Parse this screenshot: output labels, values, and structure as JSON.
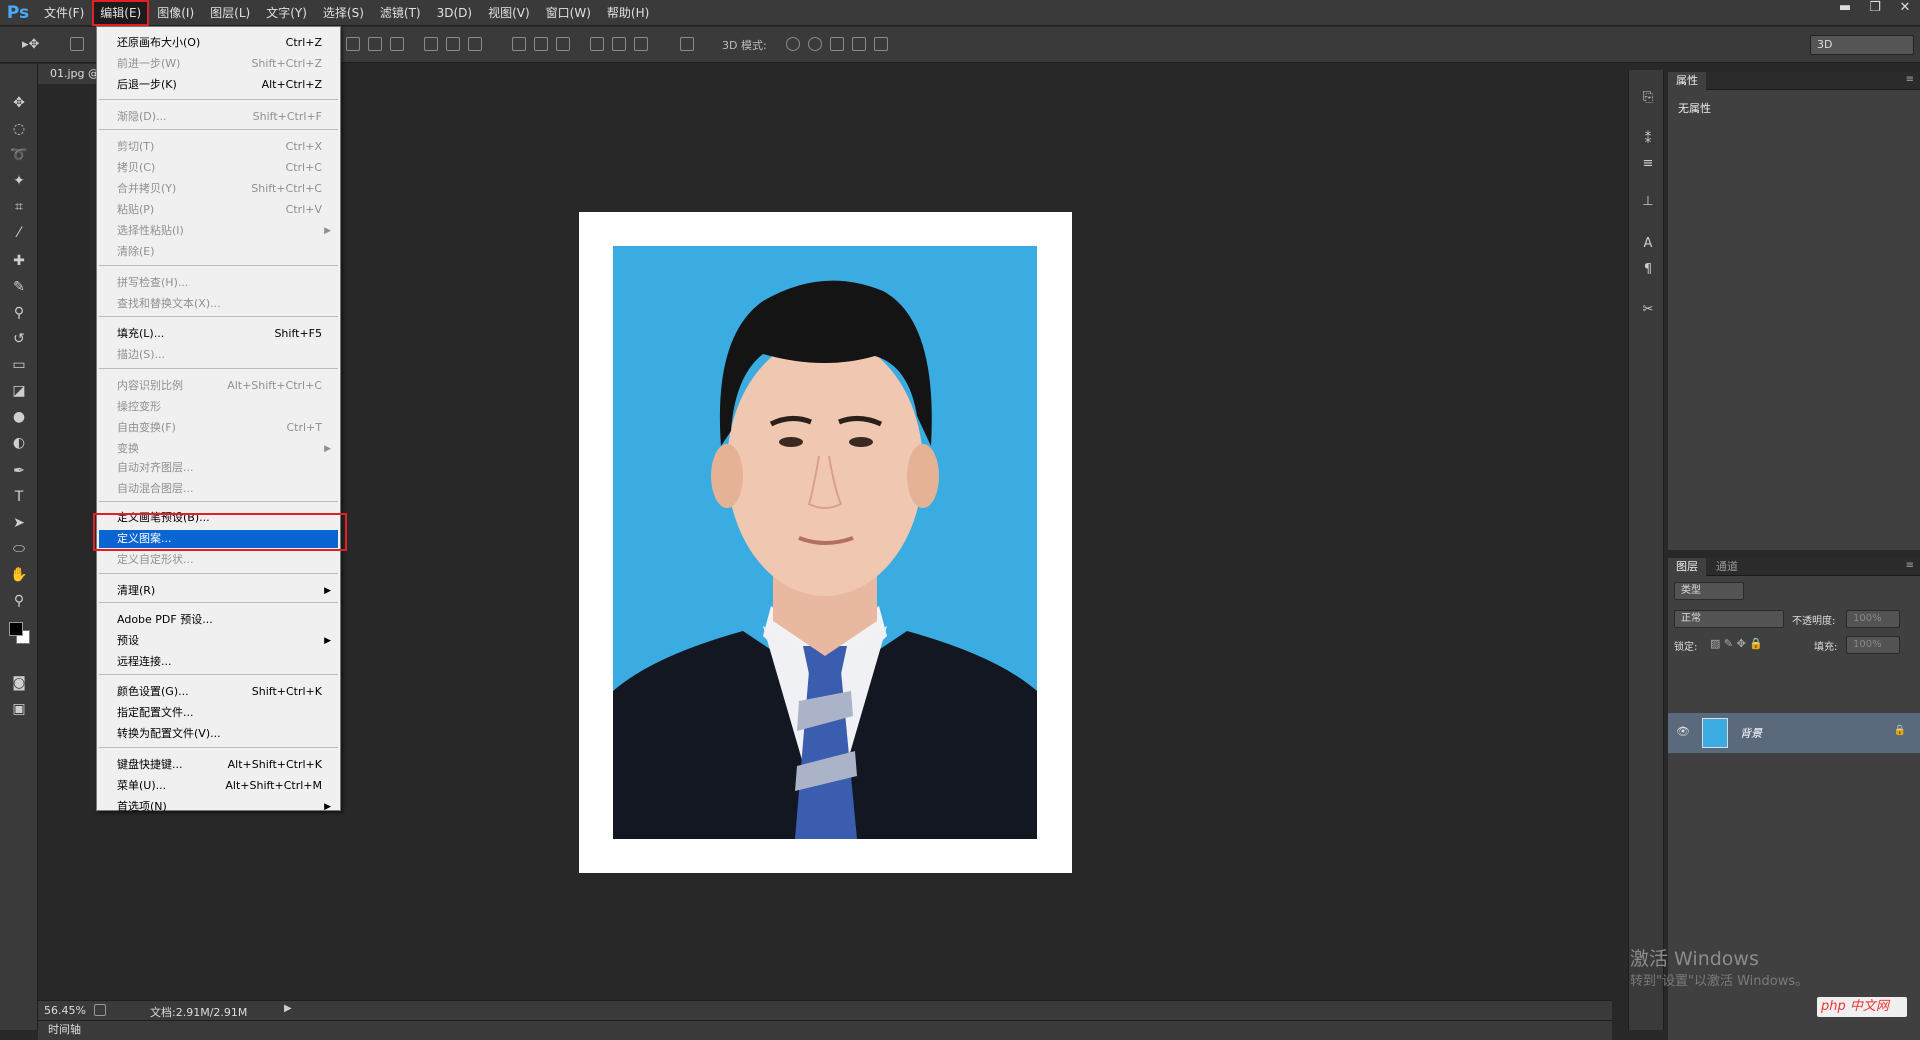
{
  "app": {
    "logo": "Ps"
  },
  "menubar": {
    "items": [
      "文件(F)",
      "编辑(E)",
      "图像(I)",
      "图层(L)",
      "文字(Y)",
      "选择(S)",
      "滤镜(T)",
      "3D(D)",
      "视图(V)",
      "窗口(W)",
      "帮助(H)"
    ],
    "active_index": 1
  },
  "window_controls": {
    "minimize": "▬",
    "restore": "❐",
    "close": "✕"
  },
  "options_bar": {
    "mode_3d_label": "3D 模式:",
    "workspace": "3D"
  },
  "document": {
    "tab_label": "01.jpg @"
  },
  "status": {
    "zoom": "56.45%",
    "doc_size": "文档:2.91M/2.91M"
  },
  "timeline": {
    "label": "时间轴"
  },
  "properties_panel": {
    "tab": "属性",
    "content": "无属性"
  },
  "layers_panel": {
    "tabs": [
      "图层",
      "通道"
    ],
    "filter_kind": "类型",
    "blend_mode": "正常",
    "opacity_label": "不透明度:",
    "opacity_value": "100%",
    "lock_label": "锁定:",
    "fill_label": "填充:",
    "fill_value": "100%",
    "layer_name": "背景"
  },
  "edit_menu": {
    "items": [
      {
        "label": "还原画布大小(O)",
        "shortcut": "Ctrl+Z",
        "state": "enabled"
      },
      {
        "label": "前进一步(W)",
        "shortcut": "Shift+Ctrl+Z",
        "state": "disabled"
      },
      {
        "label": "后退一步(K)",
        "shortcut": "Alt+Ctrl+Z",
        "state": "enabled"
      },
      {
        "label": "渐隐(D)...",
        "shortcut": "Shift+Ctrl+F",
        "state": "disabled"
      },
      {
        "label": "剪切(T)",
        "shortcut": "Ctrl+X",
        "state": "disabled"
      },
      {
        "label": "拷贝(C)",
        "shortcut": "Ctrl+C",
        "state": "disabled"
      },
      {
        "label": "合并拷贝(Y)",
        "shortcut": "Shift+Ctrl+C",
        "state": "disabled"
      },
      {
        "label": "粘贴(P)",
        "shortcut": "Ctrl+V",
        "state": "disabled"
      },
      {
        "label": "选择性粘贴(I)",
        "shortcut": "",
        "state": "disabled",
        "submenu": true
      },
      {
        "label": "清除(E)",
        "shortcut": "",
        "state": "disabled"
      },
      {
        "label": "拼写检查(H)...",
        "shortcut": "",
        "state": "disabled"
      },
      {
        "label": "查找和替换文本(X)...",
        "shortcut": "",
        "state": "disabled"
      },
      {
        "label": "填充(L)...",
        "shortcut": "Shift+F5",
        "state": "enabled"
      },
      {
        "label": "描边(S)...",
        "shortcut": "",
        "state": "disabled"
      },
      {
        "label": "内容识别比例",
        "shortcut": "Alt+Shift+Ctrl+C",
        "state": "disabled"
      },
      {
        "label": "操控变形",
        "shortcut": "",
        "state": "disabled"
      },
      {
        "label": "自由变换(F)",
        "shortcut": "Ctrl+T",
        "state": "disabled"
      },
      {
        "label": "变换",
        "shortcut": "",
        "state": "disabled",
        "submenu": true
      },
      {
        "label": "自动对齐图层...",
        "shortcut": "",
        "state": "disabled"
      },
      {
        "label": "自动混合图层...",
        "shortcut": "",
        "state": "disabled"
      },
      {
        "label": "定义画笔预设(B)...",
        "shortcut": "",
        "state": "enabled"
      },
      {
        "label": "定义图案...",
        "shortcut": "",
        "state": "highlighted"
      },
      {
        "label": "定义自定形状...",
        "shortcut": "",
        "state": "disabled"
      },
      {
        "label": "清理(R)",
        "shortcut": "",
        "state": "enabled",
        "submenu": true
      },
      {
        "label": "Adobe PDF 预设...",
        "shortcut": "",
        "state": "enabled"
      },
      {
        "label": "预设",
        "shortcut": "",
        "state": "enabled",
        "submenu": true
      },
      {
        "label": "远程连接...",
        "shortcut": "",
        "state": "enabled"
      },
      {
        "label": "颜色设置(G)...",
        "shortcut": "Shift+Ctrl+K",
        "state": "enabled"
      },
      {
        "label": "指定配置文件...",
        "shortcut": "",
        "state": "enabled"
      },
      {
        "label": "转换为配置文件(V)...",
        "shortcut": "",
        "state": "enabled"
      },
      {
        "label": "键盘快捷键...",
        "shortcut": "Alt+Shift+Ctrl+K",
        "state": "enabled"
      },
      {
        "label": "菜单(U)...",
        "shortcut": "Alt+Shift+Ctrl+M",
        "state": "enabled"
      },
      {
        "label": "首选项(N)",
        "shortcut": "",
        "state": "enabled",
        "submenu": true
      }
    ]
  },
  "os_watermark": {
    "line1": "激活 Windows",
    "line2": "转到\"设置\"以激活 Windows。"
  },
  "site_badge": {
    "text": "php 中文网"
  }
}
